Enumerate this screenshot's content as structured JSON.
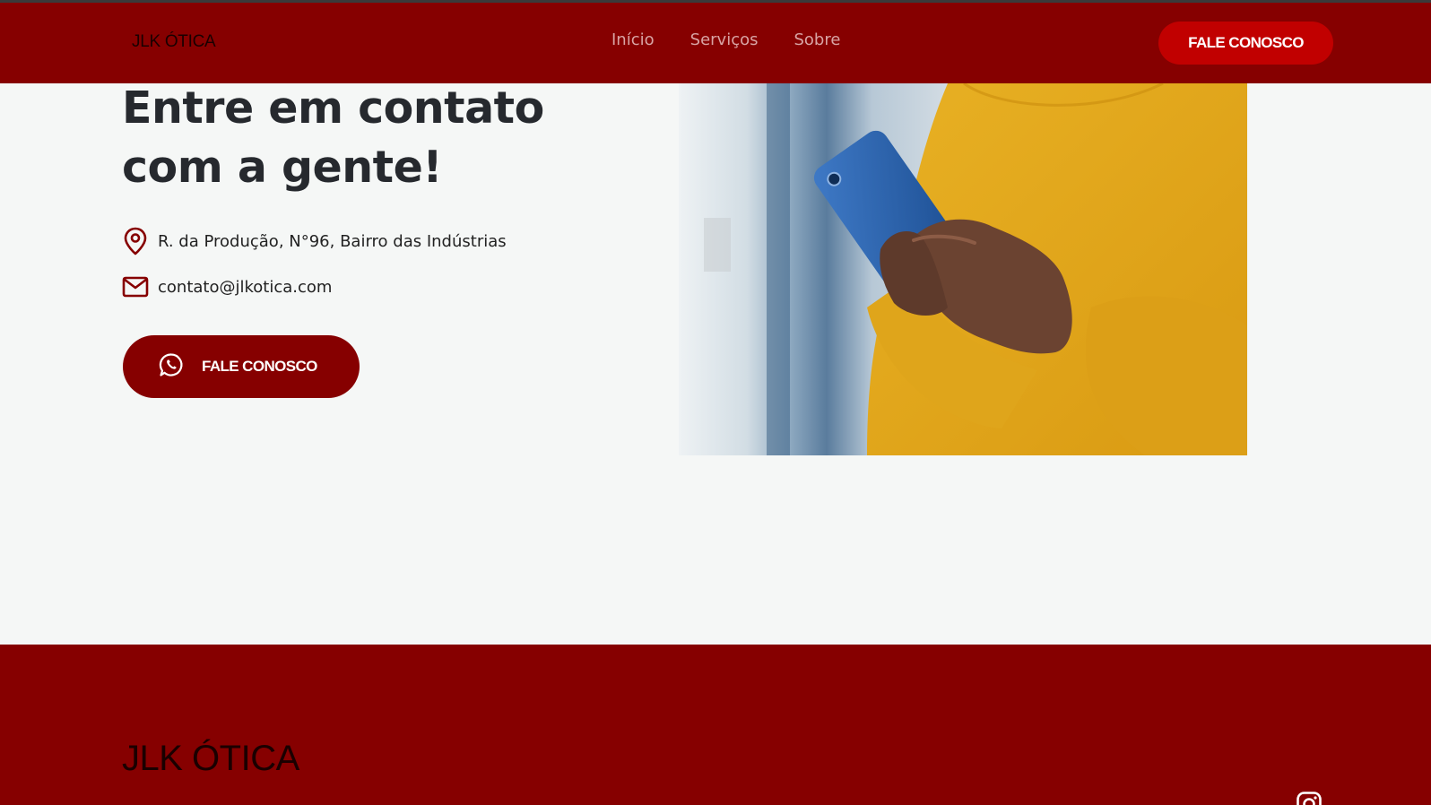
{
  "header": {
    "logo": "JLK ÓTICA",
    "nav": [
      "Início",
      "Serviços",
      "Sobre"
    ],
    "cta_label": "FALE CONOSCO"
  },
  "hero": {
    "title_line1": "Entre em contato",
    "title_line2": "com a gente!",
    "address": "R. da Produção, N°96, Bairro das Indústrias",
    "email": "contato@jlkotica.com",
    "cta_label": "FALE CONOSCO",
    "address_icon": "map-pin-icon",
    "email_icon": "mail-icon",
    "cta_icon": "whatsapp-icon"
  },
  "footer": {
    "logo": "JLK ÓTICA",
    "social_icon": "instagram-icon"
  },
  "colors": {
    "brand": "#860000",
    "accent": "#c10000",
    "text": "#26292e",
    "background": "#f5f7f6"
  }
}
